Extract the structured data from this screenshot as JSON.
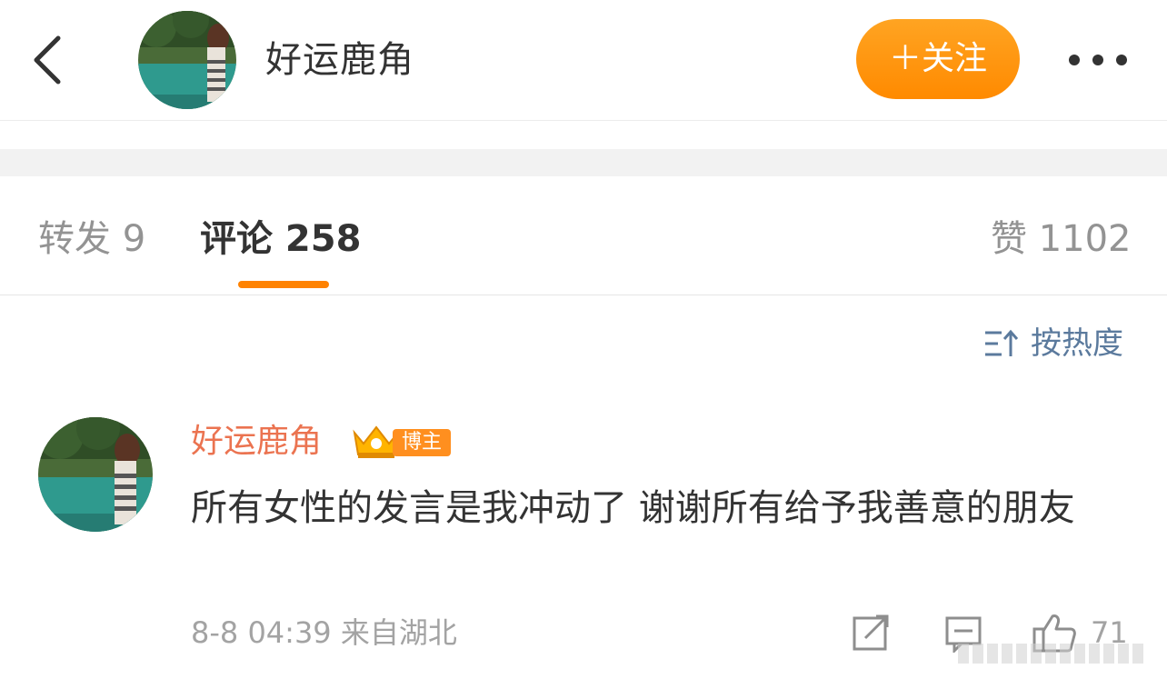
{
  "header": {
    "user_name": "好运鹿角",
    "follow_label": "＋关注"
  },
  "tabs": {
    "repost": "转发 9",
    "comments": "评论 258",
    "likes": "赞 1102"
  },
  "sort": {
    "label": "按热度",
    "icon": "sort-icon"
  },
  "comment": {
    "user_name": "好运鹿角",
    "badge": "博主",
    "text": "所有女性的发言是我冲动了 谢谢所有给予我善意的朋友",
    "meta": "8-8 04:39 来自湖北",
    "like_count": "71"
  },
  "icons": [
    "back-arrow-icon",
    "more-icon",
    "crown-icon",
    "share-icon",
    "comment-icon",
    "thumbs-up-icon"
  ],
  "colors": {
    "accent": "#ff8200",
    "follow_button": "#ff9a0f",
    "username": "#eb7350",
    "link_blue": "#5b7a9d",
    "muted": "#a3a3a3"
  }
}
